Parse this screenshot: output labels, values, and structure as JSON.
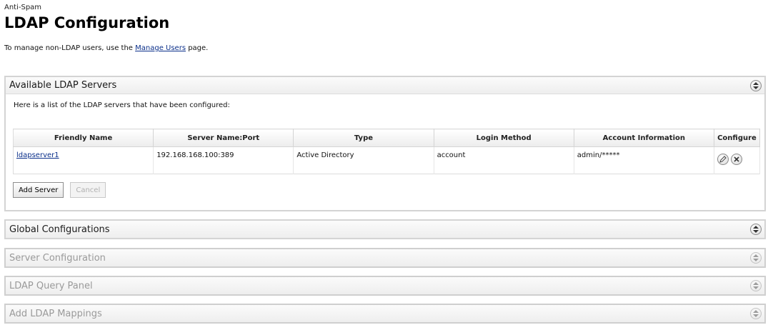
{
  "header": {
    "breadcrumb": "Anti-Spam",
    "title": "LDAP Configuration",
    "intro_before": "To manage non-LDAP users, use the ",
    "intro_link": "Manage Users",
    "intro_after": " page."
  },
  "available_servers": {
    "title": "Available LDAP Servers",
    "intro": "Here is a list of the LDAP servers that have been configured:",
    "columns": [
      "Friendly Name",
      "Server Name:Port",
      "Type",
      "Login Method",
      "Account Information",
      "Configure"
    ],
    "rows": [
      {
        "friendly_name": "ldapserver1",
        "server_port": "192.168.168.100:389",
        "type": "Active Directory",
        "login_method": "account",
        "account_info": "admin/*****"
      }
    ],
    "add_button": "Add Server",
    "cancel_button": "Cancel"
  },
  "panels": {
    "global": "Global Configurations",
    "server_config": "Server Configuration",
    "query": "LDAP Query Panel",
    "mappings": "Add LDAP Mappings"
  },
  "icons": {
    "toggle": "expand-collapse-icon",
    "edit": "pencil-icon",
    "delete": "close-icon"
  },
  "colors": {
    "link": "#0a2f8a",
    "disabled_text": "#9a9a9a",
    "panel_border": "#d4d4d4"
  }
}
